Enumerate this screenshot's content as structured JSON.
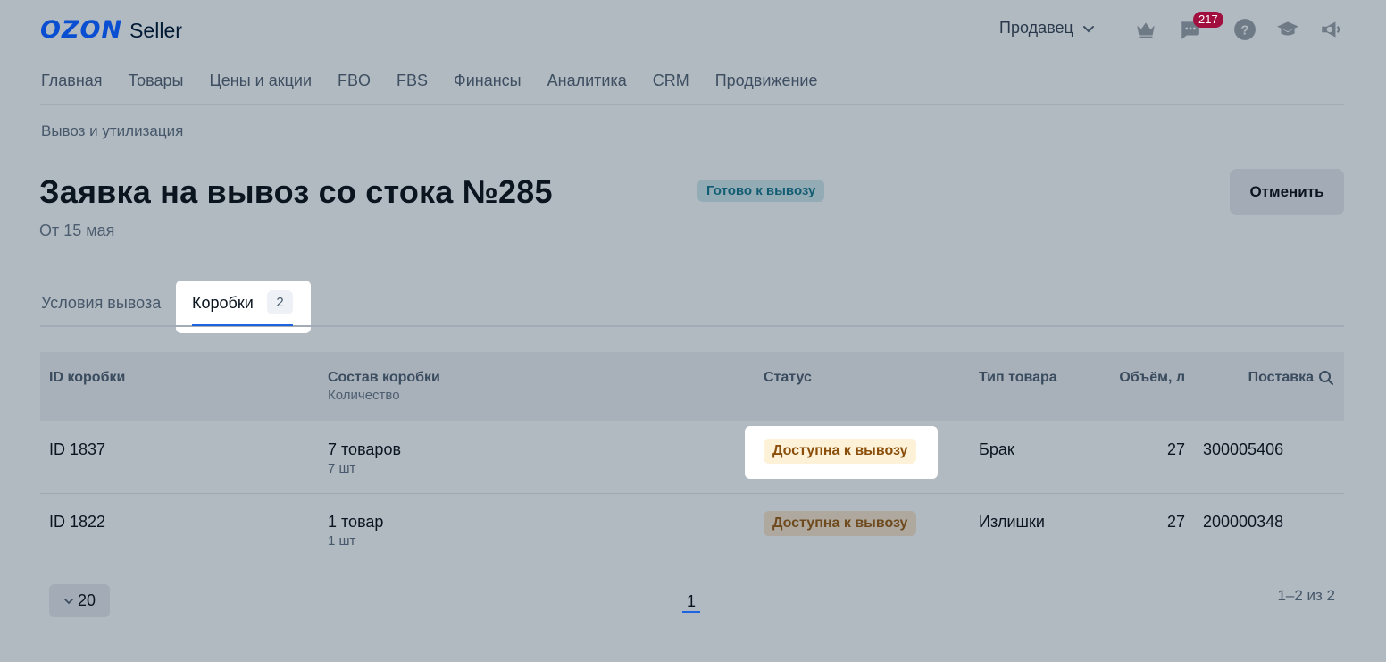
{
  "header": {
    "logo_brand": "OZON",
    "logo_product": "Seller",
    "seller_label": "Продавец",
    "messages_count": "217",
    "icons": [
      "crown-icon",
      "chat-icon",
      "help-icon",
      "education-icon",
      "megaphone-icon"
    ]
  },
  "nav": {
    "items": [
      "Главная",
      "Товары",
      "Цены и акции",
      "FBO",
      "FBS",
      "Финансы",
      "Аналитика",
      "CRM",
      "Продвижение"
    ]
  },
  "breadcrumb": "Вывоз и утилизация",
  "page": {
    "title": "Заявка на вывоз со стока №285",
    "status": "Готово к вывозу",
    "date": "От 15 мая",
    "cancel_label": "Отменить"
  },
  "tabs": [
    {
      "label": "Условия вывоза",
      "active": false
    },
    {
      "label": "Коробки",
      "count": "2",
      "active": true
    }
  ],
  "table": {
    "columns": {
      "box_id": "ID коробки",
      "composition": "Состав коробки",
      "composition_sub": "Количество",
      "status": "Статус",
      "product_type": "Тип товара",
      "volume": "Объём, л",
      "supply": "Поставка"
    },
    "rows": [
      {
        "box_id": "ID 1837",
        "composition": "7 товаров",
        "quantity": "7 шт",
        "status": "Доступна к вывозу",
        "product_type": "Брак",
        "volume": "27",
        "supply": "300005406"
      },
      {
        "box_id": "ID 1822",
        "composition": "1 товар",
        "quantity": "1 шт",
        "status": "Доступна к вывозу",
        "product_type": "Излишки",
        "volume": "27",
        "supply": "200000348"
      }
    ]
  },
  "footer": {
    "page_size": "20",
    "current_page": "1",
    "range": "1–2 из 2"
  },
  "colors": {
    "brand": "#0a4ed1",
    "accent": "#1d64e0",
    "badge": "#a10f3f",
    "overlay_bg": "#b1b9c1"
  }
}
